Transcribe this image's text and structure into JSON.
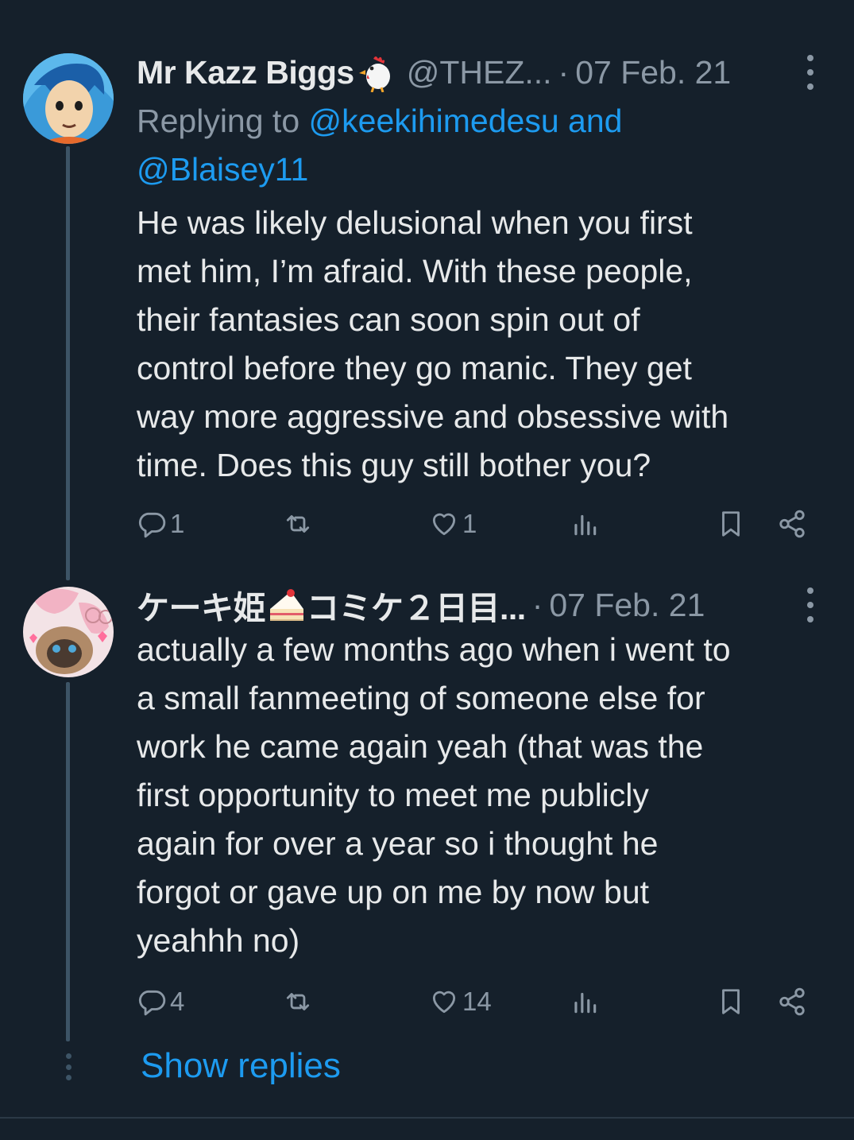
{
  "tweets": [
    {
      "name": "Mr Kazz Biggs",
      "name_emoji": "chicken-emoji",
      "handle": "@THEZ...",
      "separator": "·",
      "date": "07 Feb. 21",
      "replying_prefix": "Replying to",
      "replying_to": "@keekihimedesu and",
      "replying_to_2": "@Blaisey11",
      "lines": [
        "He was likely delusional when you first",
        "met him, I’m afraid. With these people,",
        "their fantasies can soon spin out of",
        "control before they go manic. They get",
        "way more aggressive and obsessive with",
        "time. Does this guy still bother you?"
      ],
      "replies": "1",
      "retweets": "",
      "likes": "1",
      "views": ""
    },
    {
      "name": "ケーキ姫",
      "name_emoji": "shortcake-emoji",
      "name_suffix": "コミケ２日目...",
      "handle": "",
      "separator": "·",
      "date": "07 Feb. 21",
      "lines": [
        "actually a few months ago when i went to",
        "a small fanmeeting of someone else for",
        "work he came again yeah (that was the",
        "first opportunity to meet me publicly",
        "again for over a year so i thought he",
        "forgot or gave up on me by now but",
        "yeahhh no)"
      ],
      "replies": "4",
      "retweets": "",
      "likes": "14",
      "views": ""
    }
  ],
  "show_replies": "Show replies",
  "icons": {
    "reply": "reply-icon",
    "retweet": "retweet-icon",
    "like": "heart-icon",
    "views": "views-icon",
    "bookmark": "bookmark-icon",
    "share": "share-icon",
    "more": "more-icon"
  },
  "colors": {
    "background": "#15202b",
    "text": "#e7e9ea",
    "secondary": "#8b98a5",
    "accent": "#1d9bf0",
    "thread_line": "#3d5466"
  }
}
